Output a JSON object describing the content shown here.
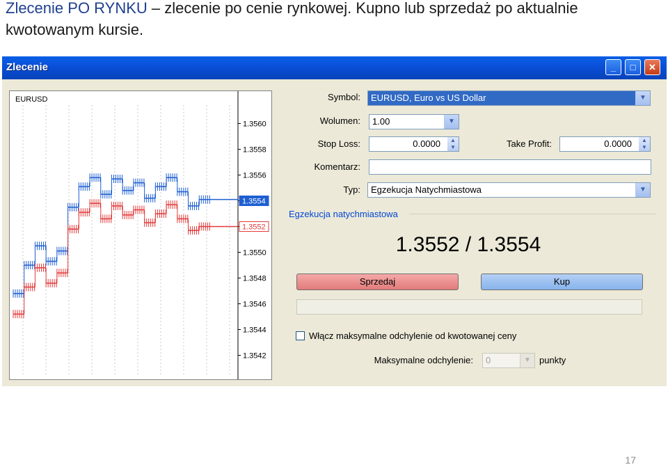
{
  "caption": {
    "strong": "Zlecenie PO RYNKU",
    "rest": " – zlecenie po cenie rynkowej. Kupno lub sprzedaż po aktualnie kwotowanym kursie."
  },
  "window": {
    "title": "Zlecenie",
    "buttons": [
      "_",
      "□",
      "✕"
    ]
  },
  "chart": {
    "symbol": "EURUSD",
    "y_ticks": [
      "1.3560",
      "1.3558",
      "1.3556",
      "1.3554",
      "1.3552",
      "1.3550",
      "1.3548",
      "1.3546",
      "1.3544",
      "1.3542"
    ],
    "ask_label": "1.3554",
    "bid_label": "1.3552",
    "ask_color": "#1e5fd2",
    "bid_color": "#e23b3b",
    "ask_series": [
      1.35468,
      1.3549,
      1.35505,
      1.35493,
      1.35501,
      1.35535,
      1.35551,
      1.35558,
      1.35545,
      1.35557,
      1.35548,
      1.35554,
      1.35542,
      1.35551,
      1.35558,
      1.35547,
      1.35536,
      1.35541
    ],
    "bid_series": [
      1.35452,
      1.35473,
      1.35488,
      1.35476,
      1.35484,
      1.35518,
      1.35531,
      1.35538,
      1.35526,
      1.35536,
      1.35529,
      1.35533,
      1.35523,
      1.3553,
      1.35537,
      1.35526,
      1.35517,
      1.3552
    ]
  },
  "form": {
    "symbol_label": "Symbol:",
    "symbol_value": "EURUSD, Euro vs US Dollar",
    "volume_label": "Wolumen:",
    "volume_value": "1.00",
    "stoploss_label": "Stop Loss:",
    "stoploss_value": "0.0000",
    "takeprofit_label": "Take Profit:",
    "takeprofit_value": "0.0000",
    "comment_label": "Komentarz:",
    "comment_value": "",
    "type_label": "Typ:",
    "type_value": "Egzekucja Natychmiastowa"
  },
  "execution": {
    "group_title": "Egzekucja natychmiastowa",
    "prices": "1.3552 / 1.3554",
    "sell_label": "Sprzedaj",
    "buy_label": "Kup",
    "deviation_checkbox_label": "Włącz maksymalne odchylenie od kwotowanej ceny",
    "max_dev_label": "Maksymalne odchylenie:",
    "max_dev_value": "0",
    "max_dev_unit": "punkty"
  },
  "slide_number": "17"
}
